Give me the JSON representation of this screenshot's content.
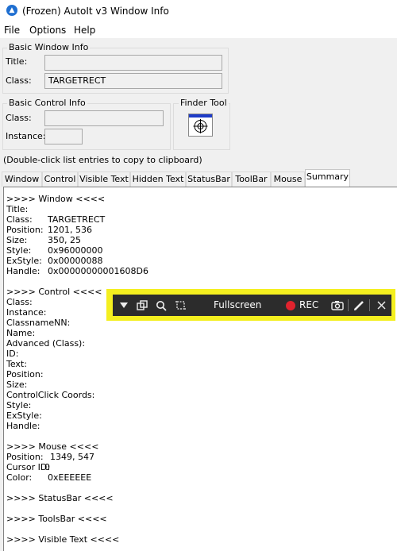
{
  "window": {
    "title": "(Frozen) AutoIt v3 Window Info",
    "icon": "autoit-logo-icon"
  },
  "menu": [
    "File",
    "Options",
    "Help"
  ],
  "basic_window_info": {
    "label": "Basic Window Info",
    "title_label": "Title:",
    "title_value": "",
    "class_label": "Class:",
    "class_value": "TARGETRECT"
  },
  "basic_control_info": {
    "label": "Basic Control Info",
    "class_label": "Class:",
    "class_value": "",
    "instance_label": "Instance:",
    "instance_value": ""
  },
  "finder_tool": {
    "label": "Finder Tool",
    "icon": "crosshair-target-icon"
  },
  "hint": "(Double-click list entries to copy to clipboard)",
  "tabs": [
    {
      "label": "Window"
    },
    {
      "label": "Control"
    },
    {
      "label": "Visible Text"
    },
    {
      "label": "Hidden Text"
    },
    {
      "label": "StatusBar"
    },
    {
      "label": "ToolBar"
    },
    {
      "label": "Mouse"
    },
    {
      "label": "Summary",
      "active": true
    }
  ],
  "summary": {
    "lines": [
      {
        "label": ">>>> Window <<<<",
        "value": ""
      },
      {
        "label": "Title:",
        "value": ""
      },
      {
        "label": "Class:",
        "value": "TARGETRECT"
      },
      {
        "label": "Position:",
        "value": "1201, 536"
      },
      {
        "label": "Size:",
        "value": "350, 25"
      },
      {
        "label": "Style:",
        "value": "0x96000000"
      },
      {
        "label": "ExStyle:",
        "value": "0x00000088"
      },
      {
        "label": "Handle:",
        "value": "0x00000000001608D6"
      },
      {
        "label": "",
        "value": ""
      },
      {
        "label": ">>>> Control <<<<",
        "value": ""
      },
      {
        "label": "Class:",
        "value": ""
      },
      {
        "label": "Instance:",
        "value": ""
      },
      {
        "label": "ClassnameNN:",
        "value": ""
      },
      {
        "label": "Name:",
        "value": ""
      },
      {
        "label": "Advanced (Class):",
        "value": ""
      },
      {
        "label": "ID:",
        "value": ""
      },
      {
        "label": "Text:",
        "value": ""
      },
      {
        "label": "Position:",
        "value": ""
      },
      {
        "label": "Size:",
        "value": ""
      },
      {
        "label": "ControlClick Coords:",
        "value": ""
      },
      {
        "label": "Style:",
        "value": ""
      },
      {
        "label": "ExStyle:",
        "value": ""
      },
      {
        "label": "Handle:",
        "value": ""
      },
      {
        "label": "",
        "value": ""
      },
      {
        "label": ">>>> Mouse <<<<",
        "value": ""
      },
      {
        "label": "Position:",
        "value": "1349, 547"
      },
      {
        "label": "Cursor ID:",
        "value": "0"
      },
      {
        "label": "Color:",
        "value": "0xEEEEEE"
      },
      {
        "label": "",
        "value": ""
      },
      {
        "label": ">>>> StatusBar <<<<",
        "value": ""
      },
      {
        "label": "",
        "value": ""
      },
      {
        "label": ">>>> ToolsBar <<<<",
        "value": ""
      },
      {
        "label": "",
        "value": ""
      },
      {
        "label": ">>>> Visible Text <<<<",
        "value": ""
      }
    ]
  },
  "recorder_toolbar": {
    "fullscreen_label": "Fullscreen",
    "rec_label": "REC",
    "frame_color": "#f4ef1f",
    "bar_color": "#2c2c2c",
    "rec_color": "#e0232e",
    "icons": [
      "dropdown-arrow-icon",
      "window-select-icon",
      "zoom-icon",
      "region-select-icon",
      "record-dot-icon",
      "camera-icon",
      "pen-icon",
      "close-icon"
    ]
  }
}
